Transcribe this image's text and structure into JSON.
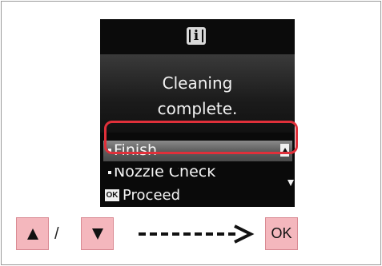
{
  "screen": {
    "info_icon": "information-icon",
    "message_line1": "Cleaning",
    "message_line2": "complete.",
    "menu": {
      "selected_item": "Finish",
      "next_item": "Nozzle Check"
    },
    "ok_badge": "OK",
    "proceed_label": "Proceed"
  },
  "guide": {
    "up_key": "up-arrow-key",
    "slash": "/",
    "down_key": "down-arrow-key",
    "arrow": "dashed-arrow-icon",
    "ok_key_label": "OK"
  },
  "colors": {
    "highlight": "#e0303a",
    "key_fill": "#f4b7bd",
    "lcd_background": "#0a0a0a"
  }
}
